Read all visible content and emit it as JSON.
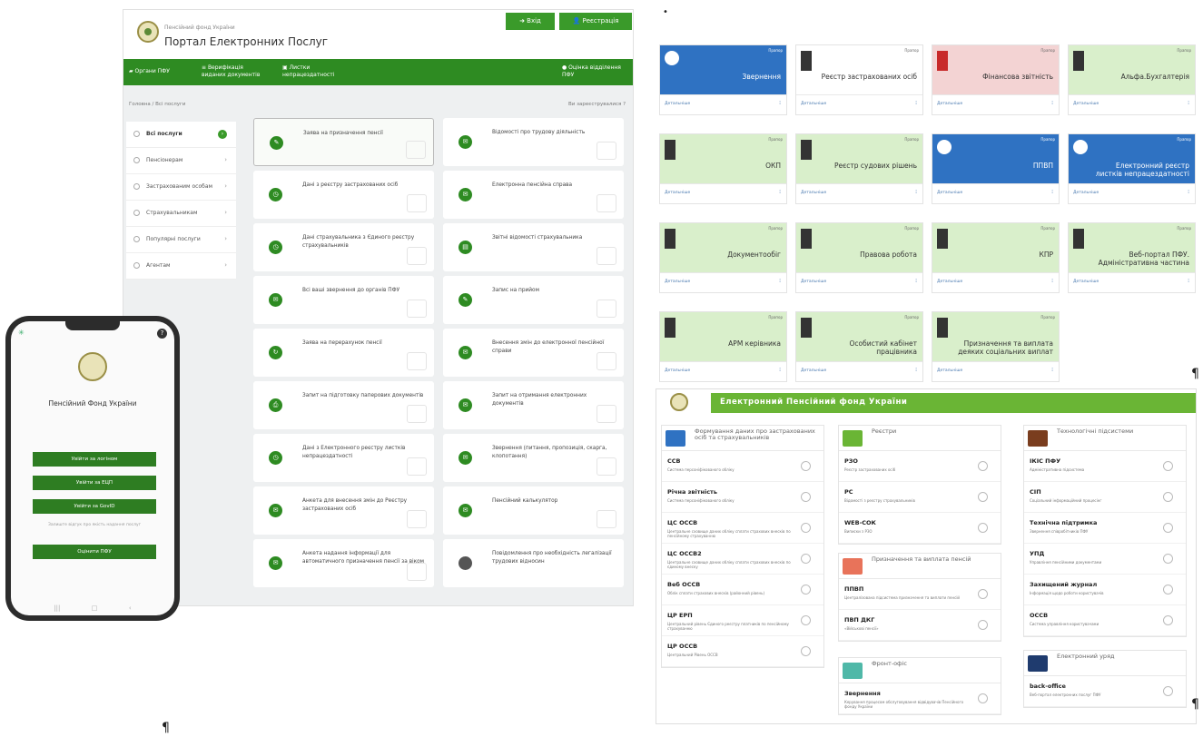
{
  "portal": {
    "org_small": "Пенсійний фонд України",
    "title": "Портал Електронних Послуг",
    "login": "Вхід",
    "register": "Реєстрація",
    "nav": [
      "Органи ПФУ",
      "Верифікація виданих документів",
      "Листки непрацездатності",
      "Оцінка відділення ПФУ"
    ],
    "breadcrumb": "Головна / Всі послуги",
    "not_registered": "Ви зареєструвалися",
    "sidebar": [
      "Всі послуги",
      "Пенсіонерам",
      "Застрахованим особам",
      "Страхувальникам",
      "Популярні послуги",
      "Агентам"
    ],
    "services": [
      "Заява на призначення пенсії",
      "Відомості про трудову діяльність",
      "Дані з реєстру застрахованих осіб",
      "Електронна пенсійна справа",
      "Дані страхувальника з Єдиного реєстру страхувальників",
      "Звітні відомості страхувальника",
      "Всі ваші звернення до органів ПФУ",
      "Запис на прийом",
      "Заява на перерахунок пенсії",
      "Внесення змін до електронної пенсійної справи",
      "Запит на підготовку паперових документів",
      "Запит на отримання електронних документів",
      "Дані з Електронного реєстру листків непрацездатності",
      "Звернення (питання, пропозиція, скарга, клопотання)",
      "Анкета для внесення змін до Реєстру застрахованих осіб",
      "Пенсійний калькулятор",
      "Анкета надання інформації для автоматичного призначення пенсії за віком",
      "Повідомлення про необхідність легалізації трудових відносин"
    ]
  },
  "phone": {
    "title": "Пенсійний Фонд України",
    "btn1": "Увійти за логіном",
    "btn2": "Увійти за ЕЦП",
    "btn3": "Увійти за GovID",
    "note": "Залиште відгук про якість надання послуг",
    "btn4": "Оцінити ПФУ"
  },
  "tiles": [
    {
      "name": "Звернення",
      "color": "blue"
    },
    {
      "name": "Реєстр застрахованих осіб",
      "color": "white"
    },
    {
      "name": "Фінансова звітність",
      "color": "red"
    },
    {
      "name": "Альфа.Бухгалтерія",
      "color": "green"
    },
    {
      "name": "ОКП",
      "color": "green"
    },
    {
      "name": "Реєстр судових рішень",
      "color": "green"
    },
    {
      "name": "ППВП",
      "color": "blue"
    },
    {
      "name": "Електронний реєстр листків непрацездатності",
      "color": "blue"
    },
    {
      "name": "Документообіг",
      "color": "green"
    },
    {
      "name": "Правова робота",
      "color": "green"
    },
    {
      "name": "КПР",
      "color": "green"
    },
    {
      "name": "Веб-портал ПФУ. Адміністративна частина",
      "color": "green"
    },
    {
      "name": "АРМ керівника",
      "color": "green"
    },
    {
      "name": "Особистий кабінет працівника",
      "color": "green"
    },
    {
      "name": "Призначення та виплата деяких соціальних виплат",
      "color": "green"
    }
  ],
  "tile_tag": "Прапор",
  "tile_more": "Детальніше",
  "epfu": {
    "title": "Електронний Пенсійний фонд України",
    "sections": [
      {
        "title": "Формування даних про застрахованих осіб та страхувальників",
        "color": "#2f72c2",
        "rows": [
          {
            "n": "ССВ",
            "d": "Система персоніфікованого обліку"
          },
          {
            "n": "Річна звітність",
            "d": "Система персоніфікованого обліку"
          },
          {
            "n": "ЦС ОССВ",
            "d": "Центральне сховище даних обліку сплати страхових внесків по пенсійному страхуванню"
          },
          {
            "n": "ЦС ОССВ2",
            "d": "Центральне сховище даних обліку сплати страхових внесків по єдиному внеску"
          },
          {
            "n": "Веб ОССВ",
            "d": "Облік сплати страхових внесків (районний рівень)"
          },
          {
            "n": "ЦР ЕРП",
            "d": "Центральний рівень Єдиного реєстру платників по пенсійному страхуванню"
          },
          {
            "n": "ЦР ОССВ",
            "d": "Центральний Рівень ОССВ"
          }
        ]
      },
      {
        "title": "Реєстри",
        "color": "#6ab535",
        "rows": [
          {
            "n": "РЗО",
            "d": "Реєстр застрахованих осіб"
          },
          {
            "n": "РС",
            "d": "Відомості з реєстру страхувальників"
          },
          {
            "n": "WEB-СОК",
            "d": "Виписки з РЗО"
          }
        ]
      },
      {
        "title": "Призначення та виплата пенсій",
        "color": "#e8735a",
        "rows": [
          {
            "n": "ППВП",
            "d": "Централізована підсистема призначення та виплати пенсій"
          },
          {
            "n": "ПВП ДКГ",
            "d": "«Військові пенсії»"
          }
        ]
      },
      {
        "title": "Фронт-офіс",
        "color": "#4fb8a8",
        "rows": [
          {
            "n": "Звернення",
            "d": "Керування процесом обслуговування відвідувачів Пенсійного фонду України"
          }
        ]
      },
      {
        "title": "Технологічні підсистеми",
        "color": "#7a3d1e",
        "rows": [
          {
            "n": "ІКІС ПФУ",
            "d": "Адміністративна підсистема"
          },
          {
            "n": "СІП",
            "d": "Соціальний інформаційний процесінг"
          },
          {
            "n": "Технічна підтримка",
            "d": "Звернення співробітників ПФУ"
          },
          {
            "n": "УПД",
            "d": "Управління пенсійними документами"
          },
          {
            "n": "Захищений журнал",
            "d": "Інформація щодо роботи користувачів"
          },
          {
            "n": "ОССВ",
            "d": "Система управління користувачами"
          }
        ]
      },
      {
        "title": "Електронний уряд",
        "color": "#1f3b6e",
        "rows": [
          {
            "n": "back-office",
            "d": "Веб-портал електронних послуг ПФУ"
          }
        ]
      }
    ]
  },
  "pilcrow": "¶"
}
